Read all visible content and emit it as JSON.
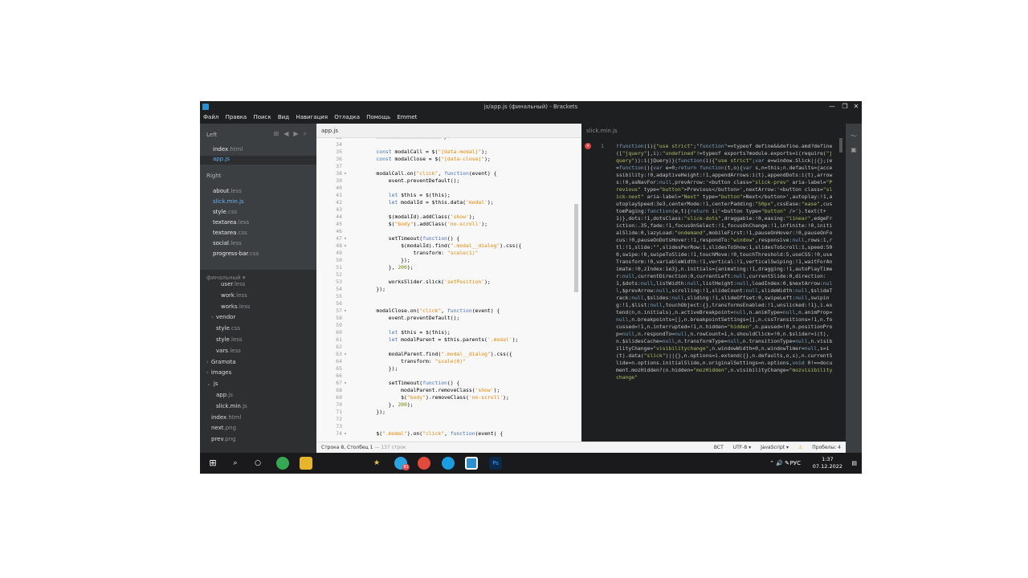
{
  "window": {
    "title": "js/app.js (финальный) - Brackets",
    "controls": [
      "—",
      "❐",
      "✕"
    ]
  },
  "menu": [
    "Файл",
    "Правка",
    "Поиск",
    "Вид",
    "Навигация",
    "Отладка",
    "Помощь",
    "Emmet"
  ],
  "sidebar": {
    "left_label": "Left",
    "right_label": "Right",
    "left_files": [
      {
        "name": "index",
        "ext": ".html"
      },
      {
        "name": "app",
        "ext": ".js"
      }
    ],
    "right_files": [
      {
        "name": "about",
        "ext": ".less"
      },
      {
        "name": "slick.min",
        "ext": ".js"
      },
      {
        "name": "style",
        "ext": ".css"
      },
      {
        "name": "textarea",
        "ext": ".less"
      },
      {
        "name": "textarea",
        "ext": ".css"
      },
      {
        "name": "social",
        "ext": ".less"
      },
      {
        "name": "progress-bar",
        "ext": ".css"
      }
    ],
    "project": "финальный ▾",
    "tree": [
      {
        "name": "user",
        "ext": ".less",
        "indent": 2,
        "arrow": ""
      },
      {
        "name": "work",
        "ext": ".less",
        "indent": 2,
        "arrow": ""
      },
      {
        "name": "works",
        "ext": ".less",
        "indent": 2,
        "arrow": ""
      },
      {
        "name": "vendor",
        "ext": "",
        "indent": 1,
        "arrow": "›"
      },
      {
        "name": "style",
        "ext": ".css",
        "indent": 1,
        "arrow": ""
      },
      {
        "name": "style",
        "ext": ".less",
        "indent": 1,
        "arrow": ""
      },
      {
        "name": "vars",
        "ext": ".less",
        "indent": 1,
        "arrow": ""
      },
      {
        "name": "Gramota",
        "ext": "",
        "indent": 0,
        "arrow": "›"
      },
      {
        "name": "images",
        "ext": "",
        "indent": 0,
        "arrow": "›"
      },
      {
        "name": "js",
        "ext": "",
        "indent": 0,
        "arrow": "⌄"
      },
      {
        "name": "app",
        "ext": ".js",
        "indent": 1,
        "arrow": ""
      },
      {
        "name": "slick.min",
        "ext": ".js",
        "indent": 1,
        "arrow": ""
      },
      {
        "name": "index",
        "ext": ".html",
        "indent": 0,
        "arrow": ""
      },
      {
        "name": "next",
        "ext": ".png",
        "indent": 0,
        "arrow": ""
      },
      {
        "name": "prev",
        "ext": ".png",
        "indent": 0,
        "arrow": ""
      }
    ]
  },
  "left_pane": {
    "tab": "app.js",
    "lines": [
      {
        "n": "33",
        "t": "    =====================*/"
      },
      {
        "n": "34",
        "t": ""
      },
      {
        "n": "35",
        "t": "    const modalCall = $(\"[data-modal]\");"
      },
      {
        "n": "36",
        "t": "    const modalClose = $(\"[data-close]\");"
      },
      {
        "n": "37",
        "t": ""
      },
      {
        "n": "38",
        "t": "    modalCall.on(\"click\", function(event) {",
        "f": true
      },
      {
        "n": "39",
        "t": "        event.preventDefault();"
      },
      {
        "n": "40",
        "t": ""
      },
      {
        "n": "41",
        "t": "        let $this = $(this);"
      },
      {
        "n": "42",
        "t": "        let modalId = $this.data('modal');"
      },
      {
        "n": "43",
        "t": ""
      },
      {
        "n": "44",
        "t": "        $(modalId).addClass('show');"
      },
      {
        "n": "45",
        "t": "        $(\"body\").addClass('no-scroll');"
      },
      {
        "n": "46",
        "t": ""
      },
      {
        "n": "47",
        "t": "        setTimeout(function() {",
        "f": true
      },
      {
        "n": "48",
        "t": "            $(modalId).find(\".modal__dialog\").css({",
        "f": true
      },
      {
        "n": "49",
        "t": "                transform: \"scale(1)\""
      },
      {
        "n": "50",
        "t": "            });"
      },
      {
        "n": "51",
        "t": "        }, 200);"
      },
      {
        "n": "52",
        "t": ""
      },
      {
        "n": "53",
        "t": "        worksSlider.slick('setPosition');"
      },
      {
        "n": "54",
        "t": "    });"
      },
      {
        "n": "55",
        "t": ""
      },
      {
        "n": "56",
        "t": ""
      },
      {
        "n": "57",
        "t": "    modalClose.on(\"click\", function(event) {",
        "f": true
      },
      {
        "n": "58",
        "t": "        event.preventDefault();"
      },
      {
        "n": "59",
        "t": ""
      },
      {
        "n": "60",
        "t": "        let $this = $(this);"
      },
      {
        "n": "61",
        "t": "        let modalParent = $this.parents('.modal');"
      },
      {
        "n": "62",
        "t": ""
      },
      {
        "n": "63",
        "t": "        modalParent.find(\".modal__dialog\").css({",
        "f": true
      },
      {
        "n": "64",
        "t": "            transform: \"scale(0)\""
      },
      {
        "n": "65",
        "t": "        });"
      },
      {
        "n": "66",
        "t": ""
      },
      {
        "n": "67",
        "t": "        setTimeout(function() {",
        "f": true
      },
      {
        "n": "68",
        "t": "            modalParent.removeClass('show');"
      },
      {
        "n": "69",
        "t": "            $(\"body\").removeClass('no-scroll');"
      },
      {
        "n": "70",
        "t": "        }, 200);"
      },
      {
        "n": "71",
        "t": "    });"
      },
      {
        "n": "72",
        "t": ""
      },
      {
        "n": "73",
        "t": ""
      },
      {
        "n": "74",
        "t": "    $(\".modal\").on(\"click\", function(event) {",
        "f": true
      }
    ]
  },
  "right_pane": {
    "tab": "slick.min.js",
    "line_number": "1",
    "error_icon": "✕",
    "text": "!function(i){\"use strict\";\"function\"==typeof define&&define.amd?define([\"jquery\"],i):\"undefined\"!=typeof exports?module.exports=i(require(\"jquery\")):i(jQuery)}(function(i){\"use strict\";var e=window.Slick||{};(e=function(){var e=0;return function(t,o){var s,n=this;n.defaults={accessibility:!0,adaptiveHeight:!1,appendArrows:i(t),appendDots:i(t),arrows:!0,asNavFor:null,prevArrow:'<button class=\"slick-prev\" aria-label=\"Previous\" type=\"button\">Previous</button>',nextArrow:'<button class=\"slick-next\" aria-label=\"Next\" type=\"button\">Next</button>',autoplay:!1,autoplaySpeed:3e3,centerMode:!1,centerPadding:\"50px\",cssEase:\"ease\",customPaging:function(e,t){return i('<button type=\"button\" />').text(t+1)},dots:!1,dotsClass:\"slick-dots\",draggable:!0,easing:\"linear\",edgeFriction:.35,fade:!1,focusOnSelect:!1,focusOnChange:!1,infinite:!0,initialSlide:0,lazyLoad:\"ondemand\",mobileFirst:!1,pauseOnHover:!0,pauseOnFocus:!0,pauseOnDotsHover:!1,respondTo:\"window\",responsive:null,rows:1,rtl:!1,slide:\"\",slidesPerRow:1,slidesToShow:1,slidesToScroll:1,speed:500,swipe:!0,swipeToSlide:!1,touchMove:!0,touchThreshold:5,useCSS:!0,useTransform:!0,variableWidth:!1,vertical:!1,verticalSwiping:!1,waitForAnimate:!0,zIndex:1e3},n.initials={animating:!1,dragging:!1,autoPlayTimer:null,currentDirection:0,currentLeft:null,currentSlide:0,direction:1,$dots:null,listWidth:null,listHeight:null,loadIndex:0,$nextArrow:null,$prevArrow:null,scrolling:!1,slideCount:null,slideWidth:null,$slideTrack:null,$slides:null,sliding:!1,slideOffset:0,swipeLeft:null,swiping:!1,$list:null,touchObject:{},transformsEnabled:!1,unslicked:!1},i.extend(n,n.initials),n.activeBreakpoint=null,n.animType=null,n.animProp=null,n.breakpoints=[],n.breakpointSettings=[],n.cssTransitions=!1,n.focussed=!1,n.interrupted=!1,n.hidden=\"hidden\",n.paused=!0,n.positionProp=null,n.respondTo=null,n.rowCount=1,n.shouldClick=!0,n.$slider=i(t),n.$slidesCache=null,n.transformType=null,n.transitionType=null,n.visibilityChange=\"visibilitychange\",n.windowWidth=0,n.windowTimer=null,s=i(t).data(\"slick\")||{},n.options=i.extend({},n.defaults,o,s),n.currentSlide=n.options.initialSlide,n.originalSettings=n.options,void 0!==document.mozHidden?(n.hidden=\"mozHidden\",n.visibilityChange=\"mozvisibilitychange\""
  },
  "status": {
    "position": "Строка 8, Столбец 1",
    "lines": "— 137 строк",
    "mode": "ВСТ",
    "encoding": "UTF-8 ▾",
    "language": "JavaScript ▾",
    "spaces": "Пробелы: 4",
    "warn": "⚠"
  },
  "taskbar": {
    "time": "1:37",
    "date": "07.12.2022",
    "lang": "РУС",
    "badge": "81"
  }
}
